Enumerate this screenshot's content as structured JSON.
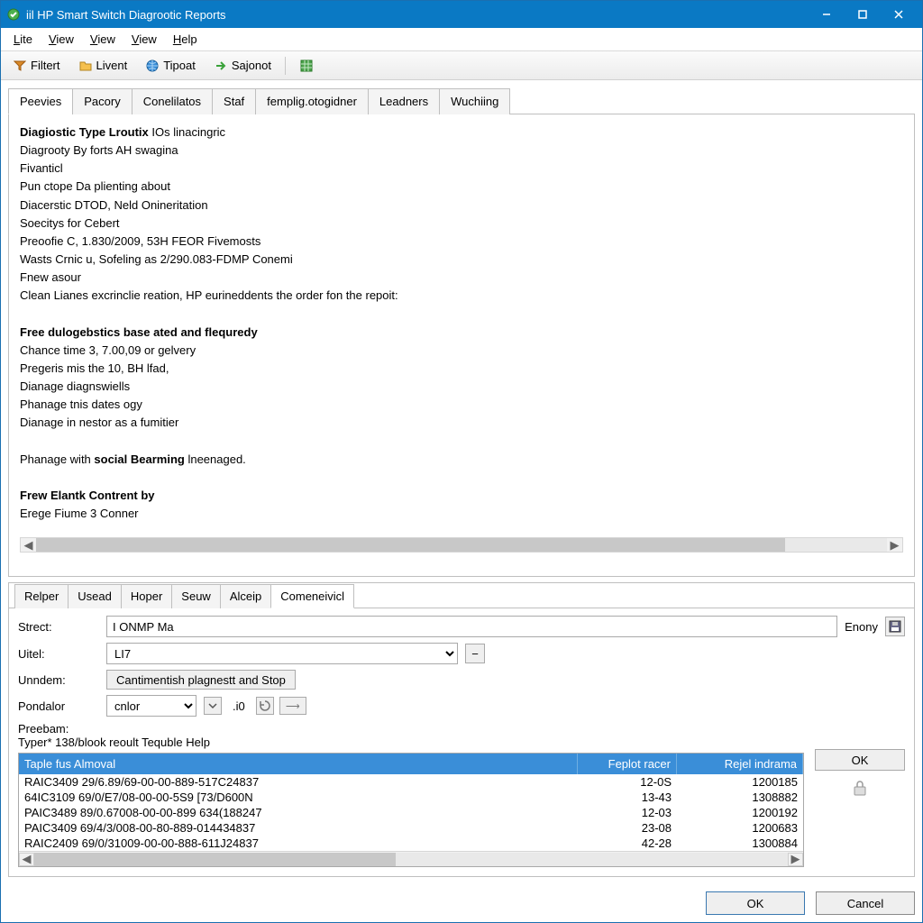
{
  "title": "iil HP Smart Switch Diagrootic Reports",
  "menu": {
    "lite": "Lite",
    "view1": "View",
    "view2": "View",
    "view3": "View",
    "help": "Help"
  },
  "toolbar": {
    "filtert": "Filtert",
    "livent": "Livent",
    "tipoat": "Tipoat",
    "sajonot": "Sajonot"
  },
  "upper_tabs": [
    "Peevies",
    "Pacory",
    "Conelilatos",
    "Staf",
    "femplig.otogidner",
    "Leadners",
    "Wuchiing"
  ],
  "doc": {
    "l1_b": "Diagiostic Type Lroutix",
    "l1_r": " IOs linacingric",
    "l2": "Diagrooty By forts AH swagina",
    "l3": "Fivanticl",
    "l4": "Pun ctope Da plienting about",
    "l5": "Diacerstic DTOD, Neld Onineritation",
    "l6": "Soecitys for Cebert",
    "l7": "Preoofie C, 1.830/2009, 53H FEOR Fivemosts",
    "l8": "Wasts Crnic u, Sofeling as 2/290.083-FDMP Conemi",
    "l9": "Fnew asour",
    "l10": "Clean Lianes excrinclie reation, HP eurineddents the order fon the repoit:",
    "h2": "Free dulogebstics base ated and flequredy",
    "l11": "Chance time 3, 7.00,09 or gelvery",
    "l12": "Pregeris mis the 10, BH lfad,",
    "l13": "Dianage diagnswiells",
    "l14": "Phanage tnis dates ogy",
    "l15": "Dianage in nestor as a fumitier",
    "l16a": "Phanage with ",
    "l16b": "social Bearming",
    "l16c": " lneenaged.",
    "h3": "Frew Elantk Contrent by",
    "l17": "Erege Fiume 3  Conner"
  },
  "lower_tabs": [
    "Relper",
    "Usead",
    "Hoper",
    "Seuw",
    "Alceip",
    "Comeneivicl"
  ],
  "form": {
    "strect_label": "Strect:",
    "strect_value": "I ONMP Ma",
    "uitel_label": "Uitel:",
    "uitel_value": "LI7",
    "unndem_label": "Unndem:",
    "unndem_btn": "Cantimentish plagnestt and Stop",
    "pondalor_label": "Pondalor",
    "pondalor_value": "cnlor",
    "spin_value": ".i0",
    "enony": "Enony",
    "preebam": "Preebam:",
    "typer": "Typer* 138/blook reoult Tequble Help"
  },
  "table": {
    "headers": [
      "Taple fus Almoval",
      "Feplot racer",
      "Rejel indrama"
    ],
    "rows": [
      [
        "RAIC3409 29/6.89/69-00-00-889-517C24837",
        "12-0S",
        "1200185"
      ],
      [
        "64IC3109 69/0/E7/08-00-00-5S9 [73/D600N",
        "13-43",
        "1308882"
      ],
      [
        "PAIC3489 89/0.67008-00-00-899 634(188247",
        "12-03",
        "1200192"
      ],
      [
        "PAIC3409 69/4/3/008-00-80-889-014434837",
        "23-08",
        "1200683"
      ],
      [
        "RAIC2409 69/0/31009-00-00-888-611J24837",
        "42-28",
        "1300884"
      ]
    ]
  },
  "buttons": {
    "ok": "OK",
    "cancel": "Cancel"
  }
}
